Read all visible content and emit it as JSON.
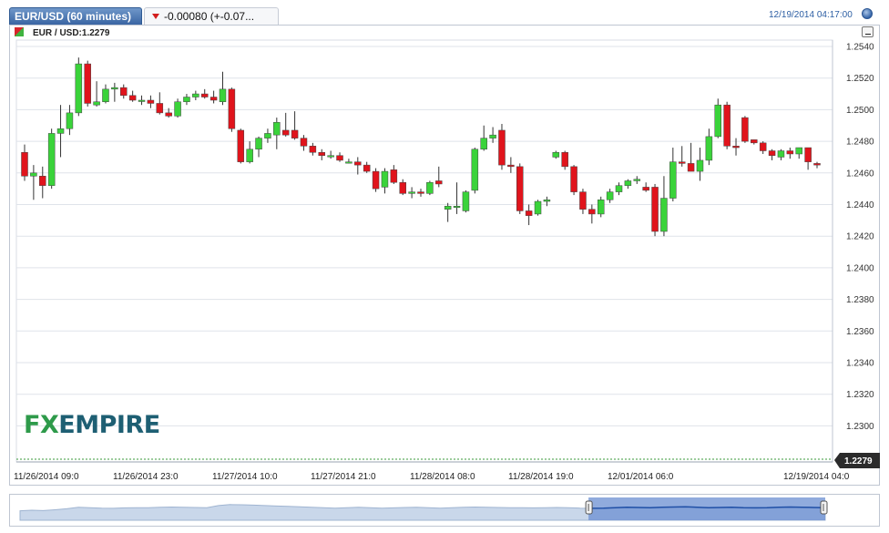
{
  "tab_title": "EUR/USD (60 minutes)",
  "change_text": "-0.00080 (+-0.07...",
  "timestamp": "12/19/2014 04:17:00",
  "legend_label": "EUR / USD:1.2279",
  "last_price_label": "1.2279",
  "logo": {
    "part1": "FX",
    "part2": "EMPIRE"
  },
  "icons": {
    "change_direction": "down-arrow-icon",
    "clock": "clock-icon",
    "collapse": "collapse-icon"
  },
  "colors": {
    "up": "#3ad33a",
    "down": "#e0141c",
    "tab": "#3a65a3",
    "accent": "#2c5ea3"
  },
  "chart_data": {
    "type": "candlestick",
    "title": "EUR/USD (60 minutes)",
    "ylim": [
      1.229,
      1.2545
    ],
    "yticks": [
      "1.2540",
      "1.2520",
      "1.2500",
      "1.2480",
      "1.2460",
      "1.2440",
      "1.2420",
      "1.2400",
      "1.2380",
      "1.2360",
      "1.2340",
      "1.2320",
      "1.2300"
    ],
    "xtick_labels": [
      "11/26/2014 09:0",
      "11/26/2014 23:0",
      "11/27/2014 10:0",
      "11/27/2014 21:0",
      "11/28/2014 08:0",
      "11/28/2014 19:0",
      "12/01/2014 06:0",
      "12/19/2014 04:0"
    ],
    "last_price": 1.2279,
    "grid": true,
    "candles": [
      {
        "o": 1.2473,
        "h": 1.2478,
        "l": 1.2455,
        "c": 1.2458
      },
      {
        "o": 1.2458,
        "h": 1.2465,
        "l": 1.2443,
        "c": 1.246
      },
      {
        "o": 1.2458,
        "h": 1.2464,
        "l": 1.2444,
        "c": 1.2452
      },
      {
        "o": 1.2452,
        "h": 1.2488,
        "l": 1.245,
        "c": 1.2485
      },
      {
        "o": 1.2485,
        "h": 1.2503,
        "l": 1.247,
        "c": 1.2488
      },
      {
        "o": 1.2488,
        "h": 1.2503,
        "l": 1.2484,
        "c": 1.2498
      },
      {
        "o": 1.2498,
        "h": 1.2533,
        "l": 1.2496,
        "c": 1.2529
      },
      {
        "o": 1.2529,
        "h": 1.2531,
        "l": 1.2502,
        "c": 1.2504
      },
      {
        "o": 1.2503,
        "h": 1.2518,
        "l": 1.2502,
        "c": 1.2505
      },
      {
        "o": 1.2505,
        "h": 1.2516,
        "l": 1.2504,
        "c": 1.2513
      },
      {
        "o": 1.2513,
        "h": 1.2517,
        "l": 1.2505,
        "c": 1.2514
      },
      {
        "o": 1.2514,
        "h": 1.2516,
        "l": 1.2507,
        "c": 1.2509
      },
      {
        "o": 1.2509,
        "h": 1.2512,
        "l": 1.2505,
        "c": 1.2506
      },
      {
        "o": 1.2506,
        "h": 1.2509,
        "l": 1.2503,
        "c": 1.2506
      },
      {
        "o": 1.2506,
        "h": 1.2509,
        "l": 1.2501,
        "c": 1.2504
      },
      {
        "o": 1.2504,
        "h": 1.2511,
        "l": 1.2497,
        "c": 1.2498
      },
      {
        "o": 1.2498,
        "h": 1.2501,
        "l": 1.2495,
        "c": 1.2496
      },
      {
        "o": 1.2496,
        "h": 1.2507,
        "l": 1.2495,
        "c": 1.2505
      },
      {
        "o": 1.2505,
        "h": 1.251,
        "l": 1.2503,
        "c": 1.2508
      },
      {
        "o": 1.2508,
        "h": 1.2512,
        "l": 1.2506,
        "c": 1.251
      },
      {
        "o": 1.251,
        "h": 1.2513,
        "l": 1.2507,
        "c": 1.2508
      },
      {
        "o": 1.2508,
        "h": 1.2512,
        "l": 1.2504,
        "c": 1.2506
      },
      {
        "o": 1.2505,
        "h": 1.2524,
        "l": 1.2503,
        "c": 1.2513
      },
      {
        "o": 1.2513,
        "h": 1.2514,
        "l": 1.2486,
        "c": 1.2488
      },
      {
        "o": 1.2487,
        "h": 1.2488,
        "l": 1.2466,
        "c": 1.2467
      },
      {
        "o": 1.2467,
        "h": 1.248,
        "l": 1.2466,
        "c": 1.2475
      },
      {
        "o": 1.2475,
        "h": 1.2483,
        "l": 1.247,
        "c": 1.2482
      },
      {
        "o": 1.2482,
        "h": 1.2488,
        "l": 1.2479,
        "c": 1.2485
      },
      {
        "o": 1.2484,
        "h": 1.2495,
        "l": 1.2475,
        "c": 1.2492
      },
      {
        "o": 1.2487,
        "h": 1.2498,
        "l": 1.2483,
        "c": 1.2484
      },
      {
        "o": 1.2487,
        "h": 1.2499,
        "l": 1.2481,
        "c": 1.2482
      },
      {
        "o": 1.2482,
        "h": 1.2484,
        "l": 1.2474,
        "c": 1.2477
      },
      {
        "o": 1.2477,
        "h": 1.2479,
        "l": 1.2471,
        "c": 1.2473
      },
      {
        "o": 1.2473,
        "h": 1.2475,
        "l": 1.2468,
        "c": 1.2471
      },
      {
        "o": 1.2471,
        "h": 1.2474,
        "l": 1.2469,
        "c": 1.2471
      },
      {
        "o": 1.2471,
        "h": 1.2473,
        "l": 1.2467,
        "c": 1.2468
      },
      {
        "o": 1.2467,
        "h": 1.2469,
        "l": 1.2466,
        "c": 1.2467
      },
      {
        "o": 1.2467,
        "h": 1.247,
        "l": 1.2459,
        "c": 1.2465
      },
      {
        "o": 1.2465,
        "h": 1.2467,
        "l": 1.246,
        "c": 1.2461
      },
      {
        "o": 1.2461,
        "h": 1.2463,
        "l": 1.2448,
        "c": 1.245
      },
      {
        "o": 1.2451,
        "h": 1.2463,
        "l": 1.2447,
        "c": 1.2461
      },
      {
        "o": 1.2462,
        "h": 1.2465,
        "l": 1.2453,
        "c": 1.2454
      },
      {
        "o": 1.2454,
        "h": 1.2456,
        "l": 1.2446,
        "c": 1.2447
      },
      {
        "o": 1.2447,
        "h": 1.2451,
        "l": 1.2444,
        "c": 1.2448
      },
      {
        "o": 1.2448,
        "h": 1.245,
        "l": 1.2445,
        "c": 1.2447
      },
      {
        "o": 1.2447,
        "h": 1.2455,
        "l": 1.2446,
        "c": 1.2454
      },
      {
        "o": 1.2455,
        "h": 1.2464,
        "l": 1.2451,
        "c": 1.2453
      },
      {
        "o": 1.2437,
        "h": 1.2441,
        "l": 1.2429,
        "c": 1.2439
      },
      {
        "o": 1.2439,
        "h": 1.2454,
        "l": 1.2434,
        "c": 1.2439
      },
      {
        "o": 1.2436,
        "h": 1.2449,
        "l": 1.2435,
        "c": 1.2448
      },
      {
        "o": 1.2449,
        "h": 1.2476,
        "l": 1.2447,
        "c": 1.2475
      },
      {
        "o": 1.2475,
        "h": 1.249,
        "l": 1.2474,
        "c": 1.2482
      },
      {
        "o": 1.2482,
        "h": 1.2489,
        "l": 1.2479,
        "c": 1.2484
      },
      {
        "o": 1.2487,
        "h": 1.2491,
        "l": 1.2462,
        "c": 1.2465
      },
      {
        "o": 1.2465,
        "h": 1.247,
        "l": 1.246,
        "c": 1.2464
      },
      {
        "o": 1.2464,
        "h": 1.2466,
        "l": 1.2434,
        "c": 1.2436
      },
      {
        "o": 1.2436,
        "h": 1.244,
        "l": 1.2427,
        "c": 1.2433
      },
      {
        "o": 1.2434,
        "h": 1.2443,
        "l": 1.2433,
        "c": 1.2442
      },
      {
        "o": 1.2442,
        "h": 1.2445,
        "l": 1.2439,
        "c": 1.2443
      },
      {
        "o": 1.247,
        "h": 1.2474,
        "l": 1.2469,
        "c": 1.2473
      },
      {
        "o": 1.2473,
        "h": 1.2474,
        "l": 1.2462,
        "c": 1.2464
      },
      {
        "o": 1.2464,
        "h": 1.2465,
        "l": 1.2446,
        "c": 1.2448
      },
      {
        "o": 1.2448,
        "h": 1.245,
        "l": 1.2434,
        "c": 1.2437
      },
      {
        "o": 1.2437,
        "h": 1.244,
        "l": 1.2428,
        "c": 1.2434
      },
      {
        "o": 1.2434,
        "h": 1.2445,
        "l": 1.2432,
        "c": 1.2443
      },
      {
        "o": 1.2443,
        "h": 1.245,
        "l": 1.2441,
        "c": 1.2448
      },
      {
        "o": 1.2448,
        "h": 1.2454,
        "l": 1.2446,
        "c": 1.2452
      },
      {
        "o": 1.2452,
        "h": 1.2456,
        "l": 1.245,
        "c": 1.2455
      },
      {
        "o": 1.2455,
        "h": 1.2458,
        "l": 1.2453,
        "c": 1.2456
      },
      {
        "o": 1.2451,
        "h": 1.2454,
        "l": 1.2448,
        "c": 1.2449
      },
      {
        "o": 1.2451,
        "h": 1.2453,
        "l": 1.242,
        "c": 1.2423
      },
      {
        "o": 1.2423,
        "h": 1.2458,
        "l": 1.242,
        "c": 1.2444
      },
      {
        "o": 1.2444,
        "h": 1.2476,
        "l": 1.2442,
        "c": 1.2467
      },
      {
        "o": 1.2467,
        "h": 1.2477,
        "l": 1.2464,
        "c": 1.2466
      },
      {
        "o": 1.2466,
        "h": 1.2479,
        "l": 1.2461,
        "c": 1.2461
      },
      {
        "o": 1.2461,
        "h": 1.2476,
        "l": 1.2455,
        "c": 1.2468
      },
      {
        "o": 1.2468,
        "h": 1.2488,
        "l": 1.2465,
        "c": 1.2483
      },
      {
        "o": 1.2483,
        "h": 1.2507,
        "l": 1.2482,
        "c": 1.2503
      },
      {
        "o": 1.2503,
        "h": 1.2505,
        "l": 1.2475,
        "c": 1.2477
      },
      {
        "o": 1.2477,
        "h": 1.2482,
        "l": 1.2471,
        "c": 1.2476
      },
      {
        "o": 1.2495,
        "h": 1.2496,
        "l": 1.2479,
        "c": 1.248
      },
      {
        "o": 1.2481,
        "h": 1.2481,
        "l": 1.2478,
        "c": 1.2479
      },
      {
        "o": 1.2479,
        "h": 1.248,
        "l": 1.2472,
        "c": 1.2474
      },
      {
        "o": 1.2474,
        "h": 1.2475,
        "l": 1.2468,
        "c": 1.2471
      },
      {
        "o": 1.247,
        "h": 1.2475,
        "l": 1.2468,
        "c": 1.2474
      },
      {
        "o": 1.2474,
        "h": 1.2476,
        "l": 1.2469,
        "c": 1.2472
      },
      {
        "o": 1.2472,
        "h": 1.2476,
        "l": 1.2469,
        "c": 1.2476
      },
      {
        "o": 1.2476,
        "h": 1.2476,
        "l": 1.2462,
        "c": 1.2467
      },
      {
        "o": 1.2466,
        "h": 1.2467,
        "l": 1.2463,
        "c": 1.2465
      }
    ],
    "navigator_series": [
      0.45,
      0.48,
      0.46,
      0.5,
      0.55,
      0.62,
      0.6,
      0.58,
      0.57,
      0.59,
      0.6,
      0.6,
      0.62,
      0.63,
      0.62,
      0.61,
      0.6,
      0.7,
      0.75,
      0.74,
      0.72,
      0.7,
      0.68,
      0.66,
      0.64,
      0.62,
      0.6,
      0.58,
      0.6,
      0.62,
      0.6,
      0.58,
      0.59,
      0.61,
      0.62,
      0.6,
      0.58,
      0.6,
      0.62,
      0.63,
      0.62,
      0.61,
      0.6,
      0.6,
      0.59,
      0.6,
      0.61,
      0.6,
      0.58,
      0.57,
      0.58,
      0.6,
      0.62,
      0.61,
      0.6,
      0.62,
      0.63,
      0.64,
      0.62,
      0.6,
      0.61,
      0.62,
      0.6,
      0.59,
      0.6,
      0.62,
      0.63,
      0.62,
      0.61,
      0.6
    ],
    "navigator_selection": [
      0.706,
      1.0
    ]
  }
}
